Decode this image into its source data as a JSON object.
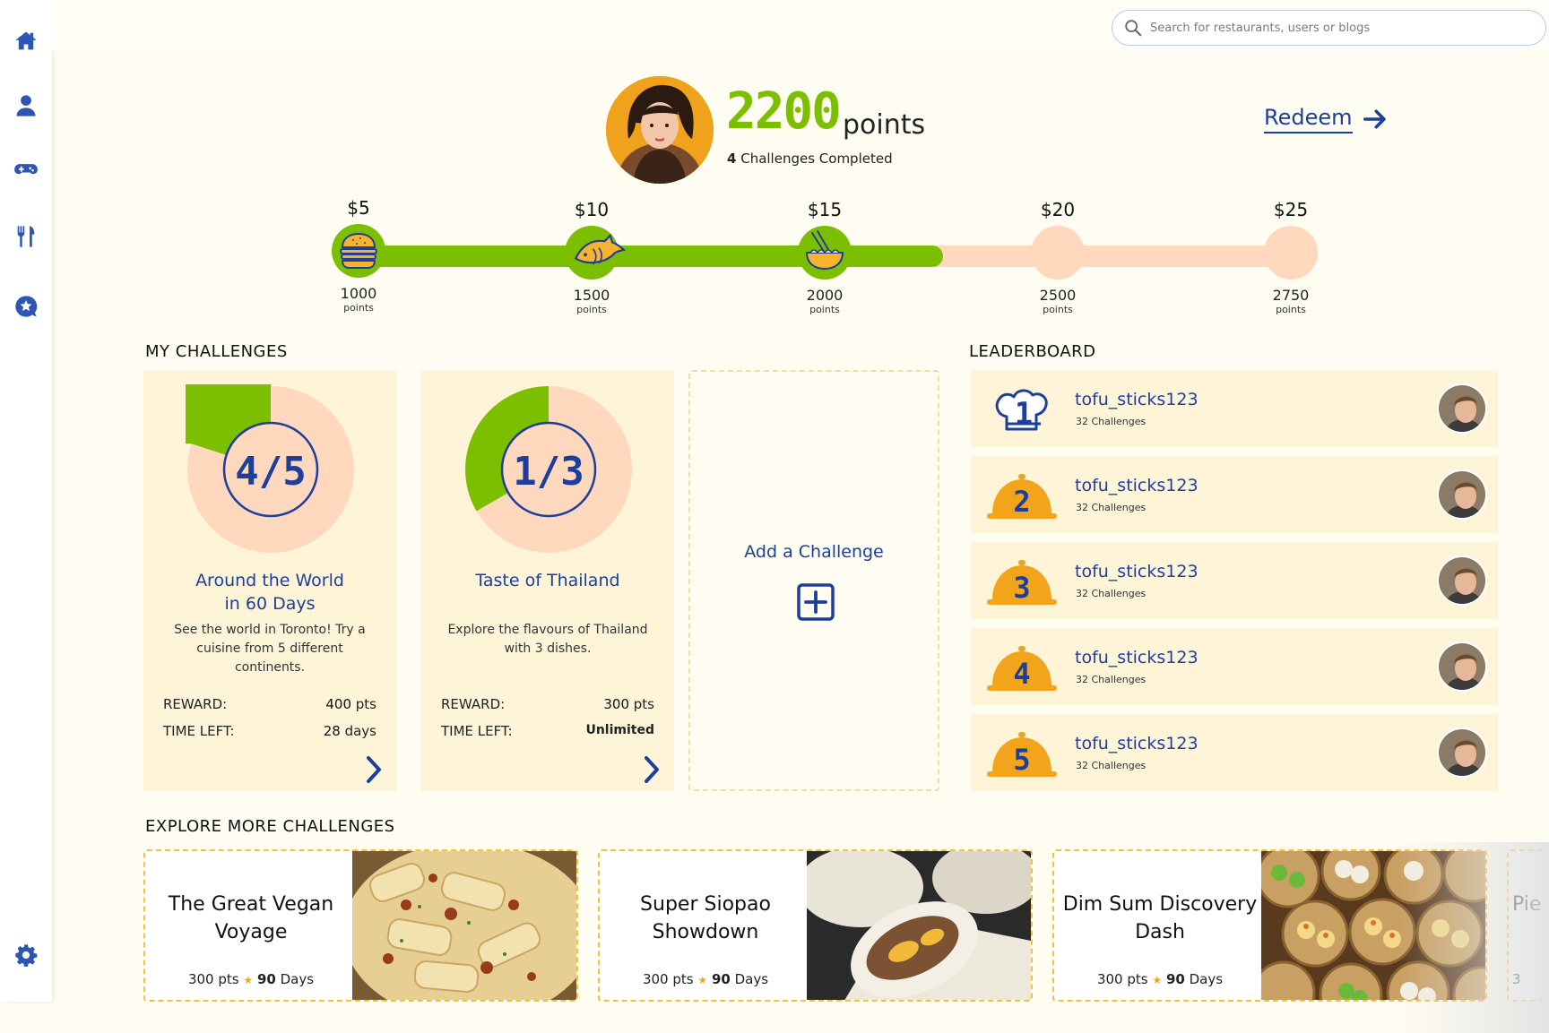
{
  "sidebar": {
    "items": [
      {
        "icon": "home-icon"
      },
      {
        "icon": "user-icon"
      },
      {
        "icon": "gamepad-icon"
      },
      {
        "icon": "utensils-icon"
      },
      {
        "icon": "star-chat-icon"
      }
    ],
    "settings_icon": "gear-icon"
  },
  "search": {
    "placeholder": "Search for restaurants, users or blogs"
  },
  "profile": {
    "points": "2200",
    "points_label": "points",
    "challenges_count": "4",
    "challenges_label": "Challenges Completed",
    "redeem_label": "Redeem"
  },
  "progress": {
    "current_points": 2200,
    "fill_fraction": 0.61,
    "milestones": [
      {
        "amount": "$5",
        "points": "1000",
        "unit": "points",
        "reached": true,
        "icon": "burger-icon"
      },
      {
        "amount": "$10",
        "points": "1500",
        "unit": "points",
        "reached": true,
        "icon": "fish-icon"
      },
      {
        "amount": "$15",
        "points": "2000",
        "unit": "points",
        "reached": true,
        "icon": "noodle-bowl-icon"
      },
      {
        "amount": "$20",
        "points": "2500",
        "unit": "points",
        "reached": false
      },
      {
        "amount": "$25",
        "points": "2750",
        "unit": "points",
        "reached": false
      }
    ]
  },
  "my_challenges": {
    "title": "MY CHALLENGES",
    "items": [
      {
        "progress_label": "4/5",
        "done": 4,
        "total": 5,
        "title_line1": "Around the World",
        "title_line2": "in 60 Days",
        "description": "See the world in Toronto! Try a cuisine from 5 different continents.",
        "reward_label": "REWARD:",
        "reward_value": "400",
        "reward_unit": "pts",
        "time_label": "TIME LEFT:",
        "time_value": "28",
        "time_unit": "days"
      },
      {
        "progress_label": "1/3",
        "done": 1,
        "total": 3,
        "title_line1": "Taste of Thailand",
        "title_line2": "",
        "description": "Explore the flavours of Thailand with 3 dishes.",
        "reward_label": "REWARD:",
        "reward_value": "300",
        "reward_unit": "pts",
        "time_label": "TIME LEFT:",
        "time_value": "Unlimited",
        "time_unit": ""
      }
    ],
    "add_label": "Add a Challenge"
  },
  "leaderboard": {
    "title": "LEADERBOARD",
    "rows": [
      {
        "rank": "1",
        "name": "tofu_sticks123",
        "challenges": "32 Challenges"
      },
      {
        "rank": "2",
        "name": "tofu_sticks123",
        "challenges": "32 Challenges"
      },
      {
        "rank": "3",
        "name": "tofu_sticks123",
        "challenges": "32 Challenges"
      },
      {
        "rank": "4",
        "name": "tofu_sticks123",
        "challenges": "32 Challenges"
      },
      {
        "rank": "5",
        "name": "tofu_sticks123",
        "challenges": "32 Challenges"
      }
    ]
  },
  "explore": {
    "title": "EXPLORE  MORE CHALLENGES",
    "cards": [
      {
        "title_line1": "The Great Vegan",
        "title_line2": "Voyage",
        "pts": "300",
        "pts_unit": "pts",
        "days": "90",
        "days_unit": "Days"
      },
      {
        "title_line1": "Super Siopao",
        "title_line2": "Showdown",
        "pts": "300",
        "pts_unit": "pts",
        "days": "90",
        "days_unit": "Days"
      },
      {
        "title_line1": "Dim Sum Discovery",
        "title_line2": "Dash",
        "pts": "300",
        "pts_unit": "pts",
        "days": "90",
        "days_unit": "Days"
      },
      {
        "title_line1": "Pie",
        "title_line2": "",
        "pts": "3",
        "pts_unit": "",
        "days": "",
        "days_unit": ""
      }
    ]
  },
  "colors": {
    "accent_green": "#7bbf00",
    "accent_blue": "#1d3f9b",
    "peach": "#ffd8bd",
    "card_bg": "#fef5d9",
    "gold": "#f2a51a"
  }
}
